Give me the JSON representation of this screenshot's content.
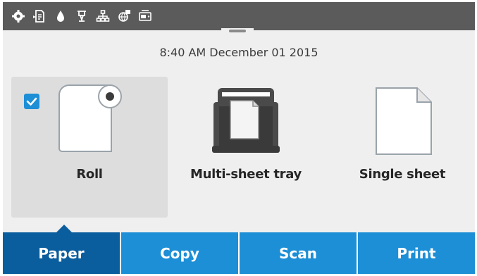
{
  "status_bar": {
    "icons": [
      "gear-icon",
      "document-status-icon",
      "ink-drop-icon",
      "printhead-icon",
      "network-icon",
      "web-services-icon",
      "storage-drive-icon"
    ]
  },
  "datetime": "8:40 AM December 01 2015",
  "sources": [
    {
      "label": "Roll",
      "icon": "paper-roll-icon",
      "selected": true
    },
    {
      "label": "Multi-sheet tray",
      "icon": "multi-sheet-tray-icon",
      "selected": false
    },
    {
      "label": "Single sheet",
      "icon": "single-sheet-icon",
      "selected": false
    }
  ],
  "tabs": [
    {
      "label": "Paper",
      "active": true
    },
    {
      "label": "Copy",
      "active": false
    },
    {
      "label": "Scan",
      "active": false
    },
    {
      "label": "Print",
      "active": false
    }
  ],
  "colors": {
    "status_bar": "#5b5b5b",
    "tab_blue": "#1d8fd6",
    "tab_active": "#0b5e9e",
    "selected_tile": "#dddddd",
    "background": "#efefef"
  }
}
